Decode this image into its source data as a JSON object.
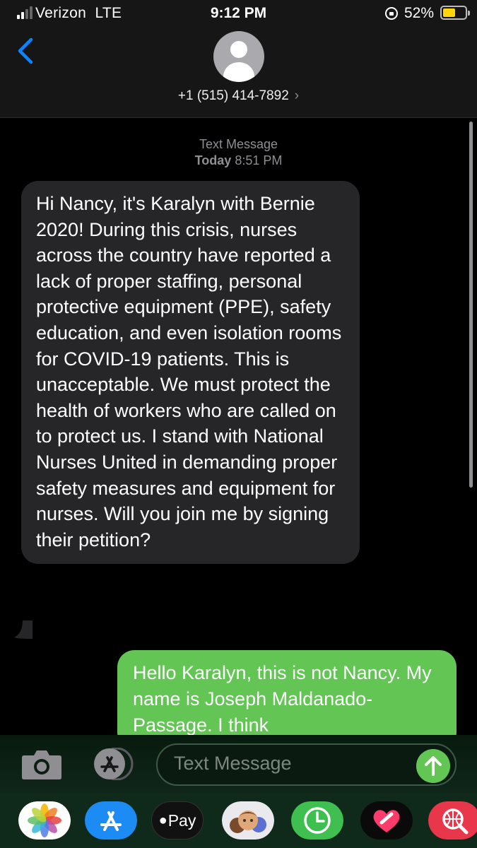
{
  "status_bar": {
    "carrier": "Verizon",
    "network": "LTE",
    "time": "9:12 PM",
    "battery": "52%",
    "battery_level": 0.52,
    "icons": [
      "signal-icon",
      "orientation-lock-icon",
      "battery-icon"
    ]
  },
  "header": {
    "contact": "+1 (515) 414-7892",
    "chevron": "›"
  },
  "thread": {
    "service": "Text Message",
    "day": "Today",
    "time": "8:51 PM"
  },
  "messages": [
    {
      "direction": "incoming",
      "text": "Hi Nancy, it's Karalyn with Bernie 2020! During this crisis, nurses across the country have reported a lack of proper staffing, personal protective equipment (PPE), safety education, and even isolation rooms for COVID-19 patients. This is unacceptable. We must protect the health of workers who are called on to protect us. I stand with National Nurses United in demanding proper safety measures and equipment for nurses. Will you join me by signing their petition?"
    },
    {
      "direction": "outgoing",
      "text": "Hello Karalyn, this is not Nancy. My name is Joseph Maldanado-Passage. I think"
    }
  ],
  "compose": {
    "placeholder": "Text Message"
  },
  "app_drawer": {
    "apple_pay_label": "Pay",
    "apps": [
      "photos-icon",
      "app-store-icon",
      "apple-pay-icon",
      "memoji-icon",
      "clock-icon",
      "heart-icon",
      "search-globe-icon"
    ]
  },
  "colors": {
    "incoming_bubble": "#262628",
    "outgoing_bubble": "#62c554",
    "accent_blue": "#0a84ff",
    "battery_fill": "#ffd60a"
  }
}
